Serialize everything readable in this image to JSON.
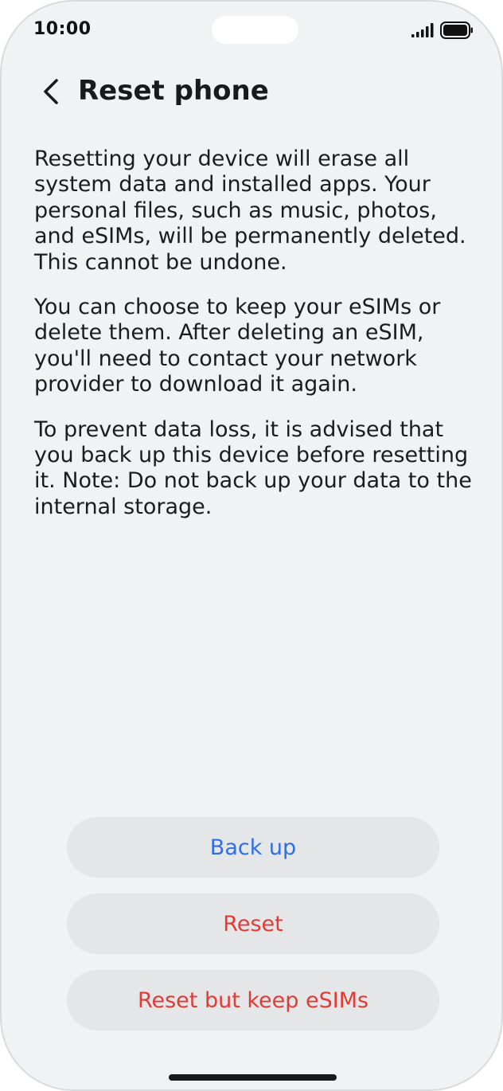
{
  "status_bar": {
    "time": "10:00",
    "signal_icon": "cellular-signal-icon",
    "battery_icon": "battery-full-icon"
  },
  "header": {
    "back_icon": "chevron-left-icon",
    "title": "Reset phone"
  },
  "body": {
    "paragraphs": [
      "Resetting your device will erase all system data and installed apps. Your personal files, such as music, photos, and eSIMs, will be permanently deleted. This cannot be undone.",
      "You can choose to keep your eSIMs or delete them. After deleting an eSIM, you'll need to contact your network provider to download it again.",
      "To prevent data loss, it is advised that you back up this device before resetting it. Note: Do not back up your data to the internal storage."
    ]
  },
  "actions": {
    "backup_label": "Back up",
    "reset_label": "Reset",
    "reset_keep_label": "Reset but keep eSIMs"
  },
  "colors": {
    "background": "#f1f2f4",
    "button_bg": "#e5e6e8",
    "accent_blue": "#2f6fe6",
    "danger_red": "#e23a35"
  }
}
